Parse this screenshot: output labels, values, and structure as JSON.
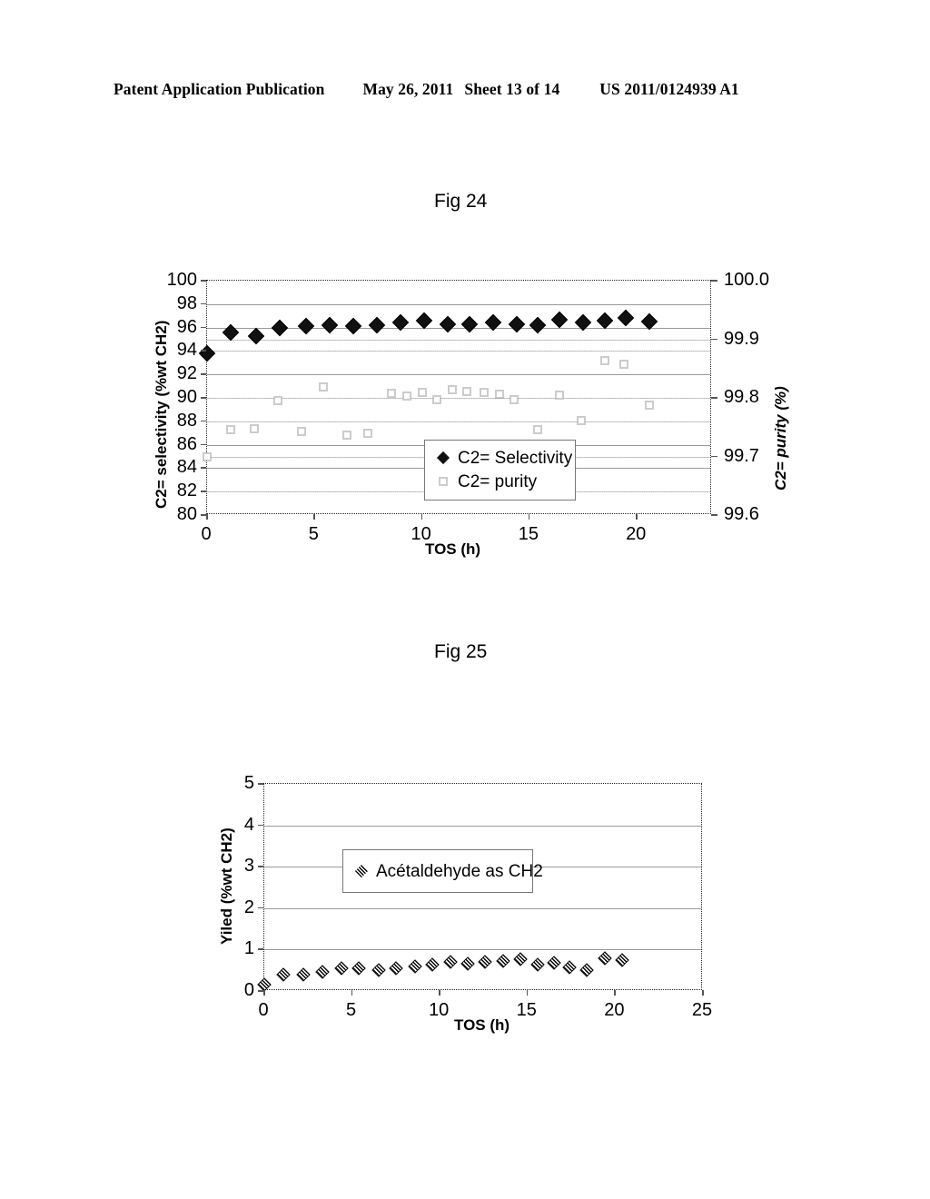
{
  "page": {
    "header": {
      "publication": "Patent Application Publication",
      "date": "May 26, 2011",
      "sheet": "Sheet 13 of 14",
      "number": "US 2011/0124939 A1"
    },
    "figures": [
      {
        "caption": "Fig 24"
      },
      {
        "caption": "Fig 25"
      }
    ]
  },
  "chart_data": [
    {
      "type": "scatter",
      "title": "Fig 24",
      "xlabel": "TOS (h)",
      "ylabel": "C2= selectivity (%wt CH2)",
      "y2label": "C2= purity (%)",
      "xlim": [
        0,
        23.5
      ],
      "ylim": [
        80,
        100
      ],
      "y2lim": [
        99.6,
        100.0
      ],
      "xticks": [
        0,
        5,
        10,
        15,
        20
      ],
      "xtick_labels": [
        "0",
        "5",
        "10",
        "15",
        "20"
      ],
      "yticks": [
        80,
        82,
        84,
        86,
        88,
        90,
        92,
        94,
        96,
        98,
        100
      ],
      "ytick_labels": [
        "80",
        "82",
        "84",
        "86",
        "88",
        "90",
        "92",
        "94",
        "96",
        "98",
        "100"
      ],
      "y2ticks": [
        99.6,
        99.7,
        99.8,
        99.9,
        100.0
      ],
      "y2tick_labels": [
        "99.6",
        "99.7",
        "99.8",
        "99.9",
        "100.0"
      ],
      "grid": true,
      "legend_position": "center",
      "series": [
        {
          "name": "C2= Selectivity",
          "marker": "filled-diamond",
          "axis": "left",
          "x": [
            0.0,
            1.1,
            2.3,
            3.4,
            4.6,
            5.7,
            6.8,
            7.9,
            9.0,
            10.1,
            11.2,
            12.2,
            13.3,
            14.4,
            15.4,
            16.4,
            17.5,
            18.5,
            19.5,
            20.6
          ],
          "y": [
            93.8,
            95.6,
            95.3,
            96.0,
            96.1,
            96.2,
            96.1,
            96.2,
            96.4,
            96.6,
            96.3,
            96.3,
            96.4,
            96.3,
            96.2,
            96.7,
            96.4,
            96.6,
            96.8,
            96.5
          ]
        },
        {
          "name": "C2= purity",
          "marker": "open-square",
          "axis": "right",
          "x": [
            0.0,
            1.1,
            2.2,
            3.3,
            4.4,
            5.4,
            6.5,
            7.5,
            8.6,
            9.3,
            10.0,
            10.7,
            11.4,
            12.1,
            12.9,
            13.6,
            14.3,
            15.4,
            16.4,
            17.4,
            18.5,
            19.4,
            20.6
          ],
          "y": [
            99.7,
            99.745,
            99.748,
            99.795,
            99.742,
            99.818,
            99.737,
            99.739,
            99.808,
            99.803,
            99.81,
            99.797,
            99.814,
            99.811,
            99.809,
            99.806,
            99.797,
            99.745,
            99.804,
            99.761,
            99.863,
            99.857,
            99.787
          ]
        }
      ]
    },
    {
      "type": "scatter",
      "title": "Fig 25",
      "xlabel": "TOS (h)",
      "ylabel": "Yiled (%wt CH2)",
      "xlim": [
        0,
        25
      ],
      "ylim": [
        0,
        5
      ],
      "xticks": [
        0,
        5,
        10,
        15,
        20,
        25
      ],
      "xtick_labels": [
        "0",
        "5",
        "10",
        "15",
        "20",
        "25"
      ],
      "yticks": [
        0,
        1,
        2,
        3,
        4,
        5
      ],
      "ytick_labels": [
        "0",
        "1",
        "2",
        "3",
        "4",
        "5"
      ],
      "grid": true,
      "legend_position": "upper-left",
      "series": [
        {
          "name": "Acétaldehyde as CH2",
          "marker": "hatched-diamond",
          "axis": "left",
          "x": [
            0.0,
            1.1,
            2.2,
            3.3,
            4.4,
            5.4,
            6.5,
            7.5,
            8.6,
            9.6,
            10.6,
            11.6,
            12.6,
            13.6,
            14.6,
            15.6,
            16.5,
            17.4,
            18.4,
            19.4,
            20.4
          ],
          "y": [
            0.16,
            0.4,
            0.4,
            0.46,
            0.54,
            0.55,
            0.51,
            0.54,
            0.6,
            0.64,
            0.7,
            0.65,
            0.7,
            0.73,
            0.77,
            0.64,
            0.68,
            0.58,
            0.5,
            0.78,
            0.74
          ]
        }
      ]
    }
  ]
}
